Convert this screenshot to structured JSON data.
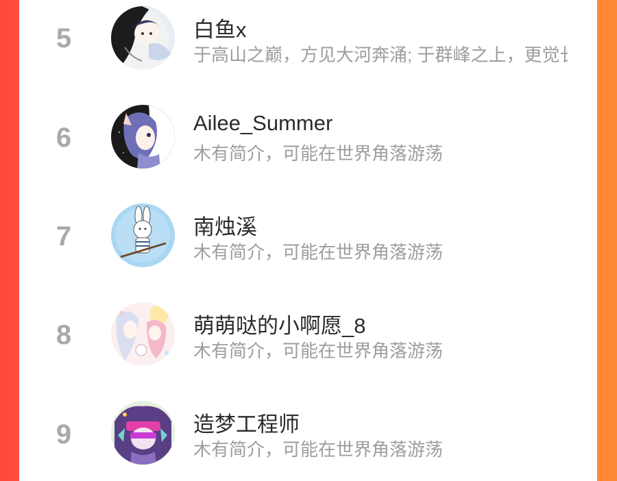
{
  "list": {
    "items": [
      {
        "rank": "5",
        "name": "白鱼x",
        "bio": "于高山之巅，方见大河奔涌; 于群峰之上，更觉长风浩荡",
        "avatar": "avatar-white-fish"
      },
      {
        "rank": "6",
        "name": "Ailee_Summer",
        "bio": "木有简介，可能在世界角落游荡",
        "avatar": "avatar-ailee"
      },
      {
        "rank": "7",
        "name": "南烛溪",
        "bio": "木有简介，可能在世界角落游荡",
        "avatar": "avatar-rabbit"
      },
      {
        "rank": "8",
        "name": "萌萌哒的小啊愿_8",
        "bio": "木有简介，可能在世界角落游荡",
        "avatar": "avatar-pastel"
      },
      {
        "rank": "9",
        "name": "造梦工程师",
        "bio": "木有简介，可能在世界角落游荡",
        "avatar": "avatar-dreamer"
      }
    ]
  },
  "colors": {
    "background_left": "#ff4a3a",
    "background_right": "#ff8a36",
    "rank": "#a9a9a9",
    "name": "#2b2b2b",
    "bio": "#9d9d9d"
  }
}
